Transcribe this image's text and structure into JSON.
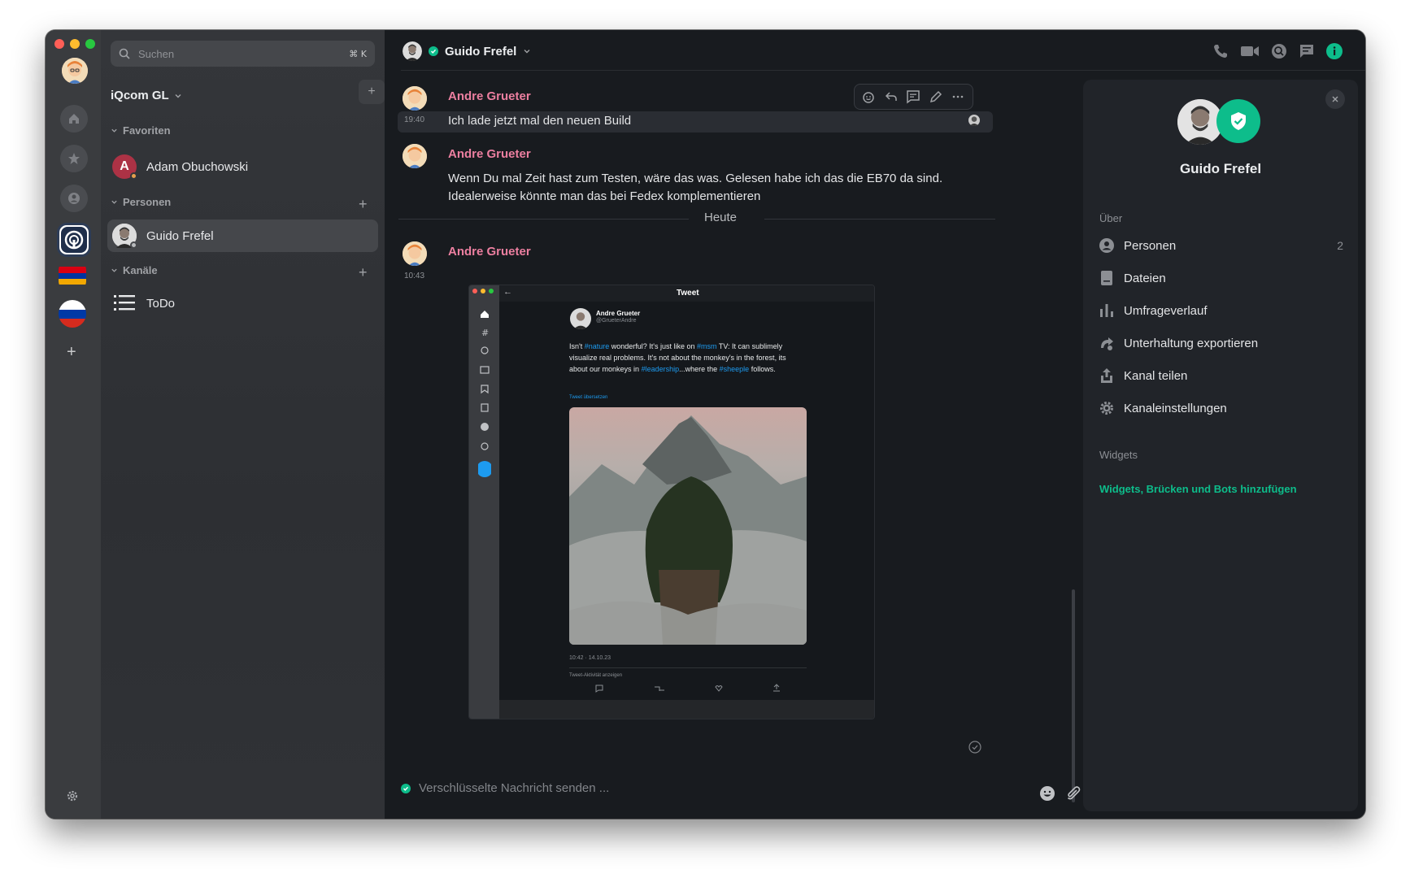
{
  "colors": {
    "accent": "#0dbd8b",
    "sender": "#ec7fa0",
    "window_bg": "#181b1f",
    "panel_bg": "#212429"
  },
  "search": {
    "placeholder": "Suchen",
    "shortcut": "⌘ K"
  },
  "space": {
    "title": "iQcom GL"
  },
  "sections": {
    "favorites": "Favoriten",
    "people": "Personen",
    "channels": "Kanäle"
  },
  "rooms": {
    "favorite": "Adam Obuchowski",
    "favorite_initial": "A",
    "person": "Guido Frefel",
    "channel": "ToDo"
  },
  "header": {
    "title": "Guido Frefel"
  },
  "messages": [
    {
      "sender": "Andre Grueter",
      "time": "19:40",
      "text": "Ich lade jetzt mal den neuen Build"
    },
    {
      "sender": "Andre Grueter",
      "line1": "Wenn Du mal Zeit hast zum Testen, wäre das was. Gelesen habe ich das die EB70 da sind.",
      "line2": "Idealerweise könnte man das bei Fedex komplementieren"
    },
    {
      "sender": "Andre Grueter",
      "time": "10:43"
    }
  ],
  "divider": "Heute",
  "tweet": {
    "window_title": "Tweet",
    "author": "Andre Grueter",
    "handle": "@GrueterAndre",
    "text_p1": "Isn't ",
    "tag_nature": "#nature",
    "text_p2": " wonderful? It's just like on ",
    "tag_msm": "#msm",
    "text_p3": " TV: It can sublimely visualize real problems. It's not about the monkey's in the forest, its about our monkeys in ",
    "tag_leadership": "#leadership",
    "text_p4": "...where the ",
    "tag_sheeple": "#sheeple",
    "text_p5": " follows.",
    "translate": "Tweet übersetzen",
    "timestamp": "10:42 · 14.10.23",
    "activity": "Tweet-Aktivität anzeigen"
  },
  "composer": {
    "placeholder": "Verschlüsselte Nachricht senden ..."
  },
  "panel": {
    "name": "Guido Frefel",
    "about": "Über",
    "items": [
      {
        "label": "Personen",
        "count": "2",
        "icon": "person-icon"
      },
      {
        "label": "Dateien",
        "icon": "file-icon"
      },
      {
        "label": "Umfrageverlauf",
        "icon": "poll-icon"
      },
      {
        "label": "Unterhaltung exportieren",
        "icon": "export-icon"
      },
      {
        "label": "Kanal teilen",
        "icon": "share-icon"
      },
      {
        "label": "Kanaleinstellungen",
        "icon": "gear-icon"
      }
    ],
    "widgets": "Widgets",
    "widgets_link": "Widgets, Brücken und Bots hinzufügen"
  }
}
